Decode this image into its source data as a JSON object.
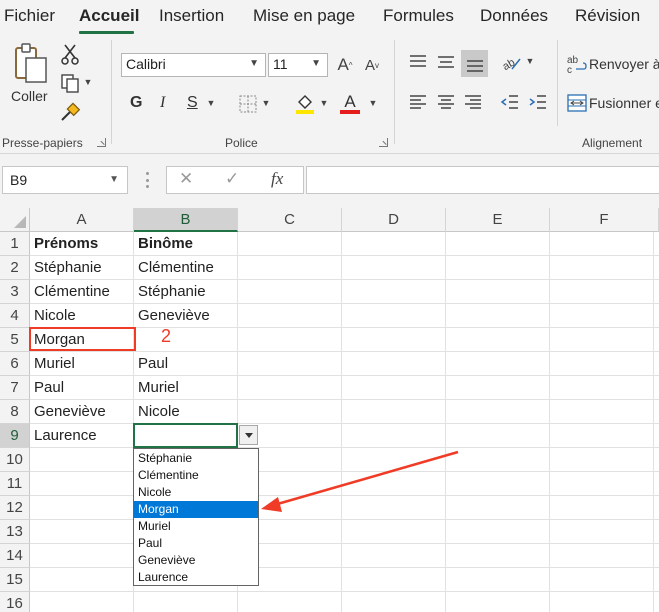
{
  "ribbon": {
    "tabs": [
      {
        "label": "Fichier",
        "active": false
      },
      {
        "label": "Accueil",
        "active": true
      },
      {
        "label": "Insertion",
        "active": false
      },
      {
        "label": "Mise en page",
        "active": false
      },
      {
        "label": "Formules",
        "active": false
      },
      {
        "label": "Données",
        "active": false
      },
      {
        "label": "Révision",
        "active": false
      }
    ],
    "clipboard": {
      "paste_label": "Coller",
      "group_label": "Presse-papiers"
    },
    "font": {
      "name": "Calibri",
      "size": "11",
      "bold": "G",
      "italic": "I",
      "underline": "S",
      "group_label": "Police",
      "highlight_color": "#ffe600",
      "font_color": "#e41c1c"
    },
    "alignment": {
      "wrap_label": "Renvoyer à",
      "merge_label": "Fusionner e",
      "group_label": "Alignement"
    }
  },
  "formula_bar": {
    "name_box": "B9",
    "cancel_icon": "✕",
    "enter_icon": "✓",
    "fx_label": "fx",
    "formula": ""
  },
  "grid": {
    "columns": [
      "A",
      "B",
      "C",
      "D",
      "E",
      "F"
    ],
    "selected_column": "B",
    "rows": [
      "1",
      "2",
      "3",
      "4",
      "5",
      "6",
      "7",
      "8",
      "9",
      "10",
      "11",
      "12",
      "13",
      "14",
      "15",
      "16"
    ],
    "selected_row": "9",
    "cells": {
      "col_a": [
        "Prénoms",
        "Stéphanie",
        "Clémentine",
        "Nicole",
        "Morgan",
        "Muriel",
        "Paul",
        "Geneviève",
        "Laurence"
      ],
      "col_b": [
        "Binôme",
        "Clémentine",
        "Stéphanie",
        "Geneviève",
        "",
        "Paul",
        "Muriel",
        "Nicole",
        ""
      ]
    }
  },
  "annotation": {
    "label": "2",
    "color": "#f03b26"
  },
  "dropdown": {
    "items": [
      "Stéphanie",
      "Clémentine",
      "Nicole",
      "Morgan",
      "Muriel",
      "Paul",
      "Geneviève",
      "Laurence"
    ],
    "selected": "Morgan",
    "selected_color": "#0078d7"
  },
  "colors": {
    "excel_green": "#217346",
    "annotation_red": "#f03b26"
  }
}
